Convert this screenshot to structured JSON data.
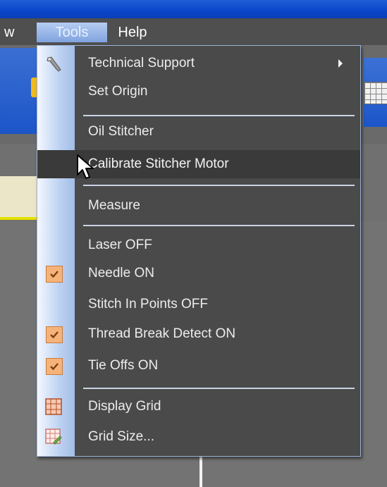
{
  "menubar": {
    "items": [
      "w",
      "Tools",
      "Help"
    ]
  },
  "menu": {
    "title": "Tools",
    "items": [
      {
        "label": "Technical Support",
        "icon": "wrench-icon",
        "submenu": true
      },
      {
        "label": "Set Origin"
      },
      {
        "label": "Oil Stitcher"
      },
      {
        "label": "Calibrate Stitcher Motor",
        "highlighted": true
      },
      {
        "label": "Measure"
      },
      {
        "label": "Laser OFF",
        "checked": false
      },
      {
        "label": "Needle ON",
        "checked": true
      },
      {
        "label": "Stitch In Points OFF",
        "checked": false
      },
      {
        "label": "Thread Break Detect ON",
        "checked": true
      },
      {
        "label": "Tie Offs ON",
        "checked": true
      },
      {
        "label": "Display Grid",
        "icon": "grid-icon"
      },
      {
        "label": "Grid Size...",
        "icon": "grid-size-icon"
      }
    ]
  },
  "colors": {
    "menu_bg": "#4a4a4a",
    "highlight_bg": "#3a3a3a",
    "check_bg": "#f5b37a",
    "gutter": "#bcd1f1",
    "titlebar": "#0b46c9"
  }
}
